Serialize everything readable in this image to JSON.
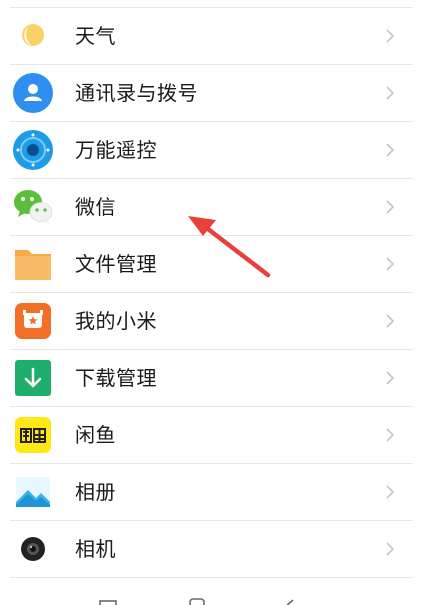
{
  "items": [
    {
      "label": "天气",
      "icon": "weather-sun-icon"
    },
    {
      "label": "通讯录与拨号",
      "icon": "contacts-icon"
    },
    {
      "label": "万能遥控",
      "icon": "remote-control-icon"
    },
    {
      "label": "微信",
      "icon": "wechat-icon"
    },
    {
      "label": "文件管理",
      "icon": "folder-icon"
    },
    {
      "label": "我的小米",
      "icon": "mi-account-icon"
    },
    {
      "label": "下载管理",
      "icon": "download-icon"
    },
    {
      "label": "闲鱼",
      "icon": "xianyu-icon"
    },
    {
      "label": "相册",
      "icon": "gallery-icon"
    },
    {
      "label": "相机",
      "icon": "camera-icon"
    }
  ],
  "colors": {
    "accent_arrow": "#e8403a",
    "contacts_blue": "#2e8ff0",
    "remote_blue": "#1e9be6",
    "wechat_green": "#5bbf3a",
    "folder_orange": "#f7b65a",
    "mi_orange": "#f36f28",
    "download_green": "#1fae6a",
    "xianyu_yellow": "#ffe816",
    "gallery_blue": "#34b4ee"
  }
}
